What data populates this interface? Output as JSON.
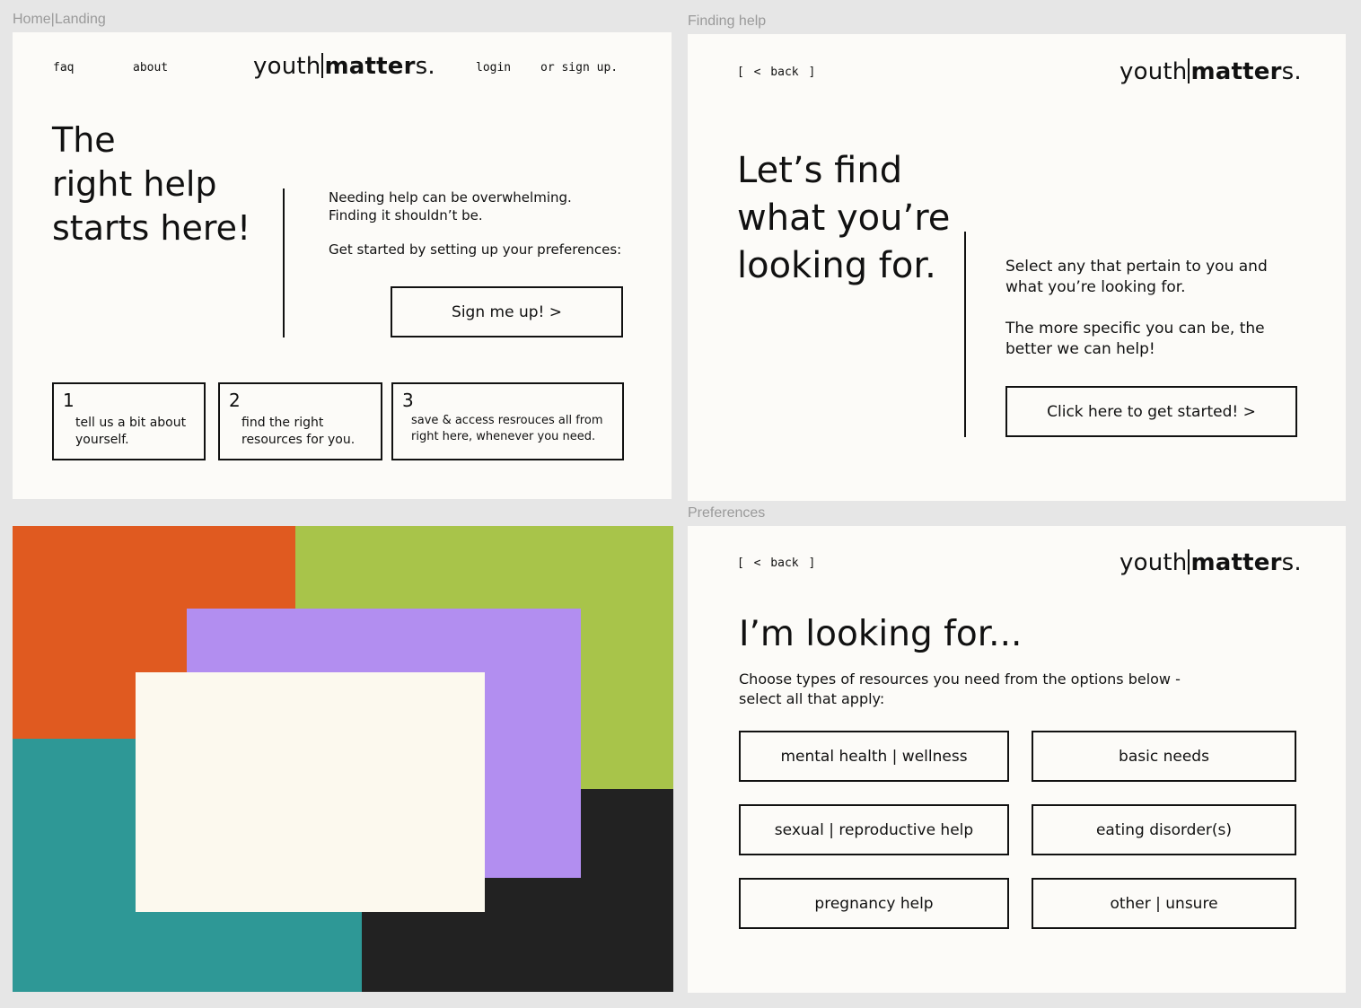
{
  "labels": {
    "landing": "Home|Landing",
    "finding": "Finding help",
    "preferences": "Preferences"
  },
  "logo": {
    "light": "youth",
    "bold": "matter",
    "light_end": "s."
  },
  "landing": {
    "nav": {
      "faq": "faq",
      "about": "about",
      "login": "login",
      "signup": "or sign up."
    },
    "headline": [
      "The",
      "right help",
      "starts here!"
    ],
    "intro_1": "Needing help can be overwhelming.",
    "intro_2": "Finding it shouldn’t be.",
    "intro_3": "Get started by setting up your preferences:",
    "cta": "Sign me up! >",
    "steps": [
      {
        "num": "1",
        "line1": "tell us a bit about",
        "line2": "yourself."
      },
      {
        "num": "2",
        "line1": "find the right",
        "line2": "resources for you."
      },
      {
        "num": "3",
        "line1": "save & access resrouces all from",
        "line2": "right here, whenever you need."
      }
    ]
  },
  "finding": {
    "back": "[ < back ]",
    "headline": [
      "Let’s find",
      "what you’re",
      "looking for."
    ],
    "text_1a": "Select any that pertain to you and",
    "text_1b": "what you’re looking for.",
    "text_2a": "The more specific you can be, the",
    "text_2b": "better we can help!",
    "cta": "Click here to get started!  >"
  },
  "preferences": {
    "back": "[ < back ]",
    "headline": "I’m looking for...",
    "desc_a": "Choose types of resources you need from the options below -",
    "desc_b": "select all that apply:",
    "options": [
      "mental health | wellness",
      "basic needs",
      "sexual | reproductive help",
      "eating disorder(s)",
      "pregnancy help",
      "other | unsure"
    ]
  },
  "palette": {
    "orange": "#e05a20",
    "green": "#a8c44a",
    "purple": "#b28ef0",
    "teal": "#2e9896",
    "black": "#222222",
    "cream": "#fcf9ee"
  }
}
